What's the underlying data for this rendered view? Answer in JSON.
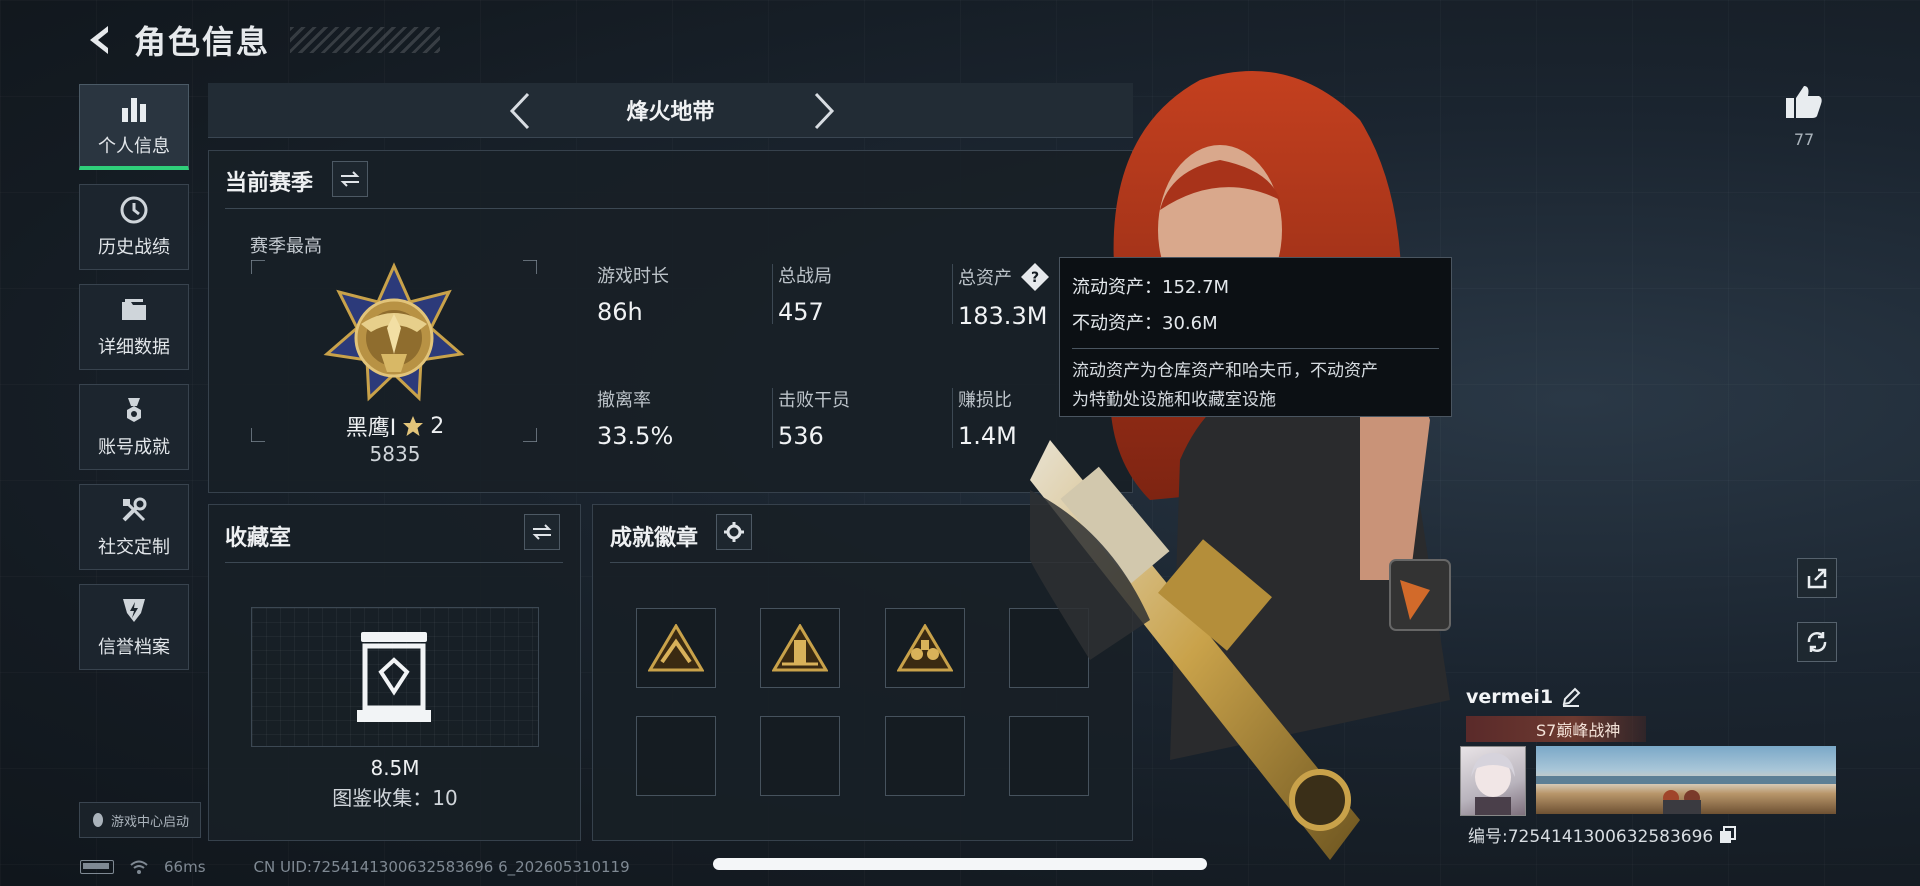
{
  "header": {
    "title": "角色信息"
  },
  "nav": {
    "items": [
      {
        "label": "个人信息",
        "icon": "bar-chart-icon",
        "active": true
      },
      {
        "label": "历史战绩",
        "icon": "clock-icon"
      },
      {
        "label": "详细数据",
        "icon": "folder-icon"
      },
      {
        "label": "账号成就",
        "icon": "medal-icon"
      },
      {
        "label": "社交定制",
        "icon": "tools-icon"
      },
      {
        "label": "信誉档案",
        "icon": "shield-icon"
      }
    ],
    "game_center": "游戏中心启动"
  },
  "mode": {
    "title": "烽火地带"
  },
  "season": {
    "title": "当前赛季",
    "best_label": "赛季最高",
    "rank_name": "黑鹰I",
    "rank_stars": "2",
    "rank_score": "5835",
    "stats": [
      {
        "label": "游戏时长",
        "value": "86h"
      },
      {
        "label": "总战局",
        "value": "457"
      },
      {
        "label": "总资产",
        "value": "183.3M",
        "help": "?"
      },
      {
        "label": "撤离率",
        "value": "33.5%"
      },
      {
        "label": "击败干员",
        "value": "536"
      },
      {
        "label": "赚损比",
        "value": "1.4M"
      }
    ]
  },
  "tooltip": {
    "liquid": "流动资产：152.7M",
    "fixed": "不动资产：30.6M",
    "desc_line1": "流动资产为仓库资产和哈夫币，不动资产",
    "desc_line2": "为特勤处设施和收藏室设施"
  },
  "collection": {
    "title": "收藏室",
    "value": "8.5M",
    "count": "图鉴收集：10"
  },
  "badges": {
    "title": "成就徽章",
    "filled": 3,
    "total": 8
  },
  "social": {
    "like_count": "77"
  },
  "player": {
    "name": "vermei1",
    "title": "S7巅峰战神",
    "uid": "编号:7254141300632583696"
  },
  "status": {
    "ping": "66ms",
    "cn_uid": "CN UID:7254141300632583696 6_202605310119"
  },
  "colors": {
    "accent": "#2fcf7a",
    "gold": "#c9a24a",
    "hair": "#b8361e"
  }
}
